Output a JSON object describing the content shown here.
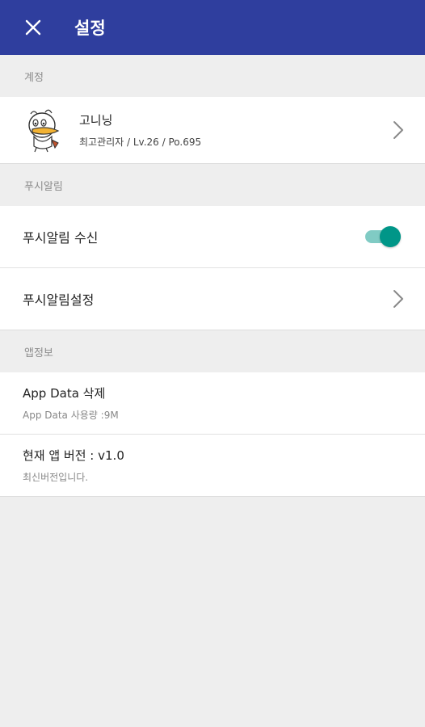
{
  "header": {
    "title": "설정",
    "close_icon": "close-icon"
  },
  "sections": {
    "account": {
      "header": "계정",
      "name": "고니닝",
      "details": "최고관리자 / Lv.26 / Po.695"
    },
    "push": {
      "header": "푸시알림",
      "receive_label": "푸시알림 수신",
      "receive_enabled": true,
      "settings_label": "푸시알림설정"
    },
    "app_info": {
      "header": "앱정보",
      "delete_title": "App Data 삭제",
      "delete_sub": "App Data 사용량 :9M",
      "version_title": "현재 앱 버전 : v1.0",
      "version_sub": "최신버전입니다."
    }
  },
  "colors": {
    "appbar": "#2f3e9e",
    "toggle_on": "#009688",
    "background": "#eeeeee"
  }
}
